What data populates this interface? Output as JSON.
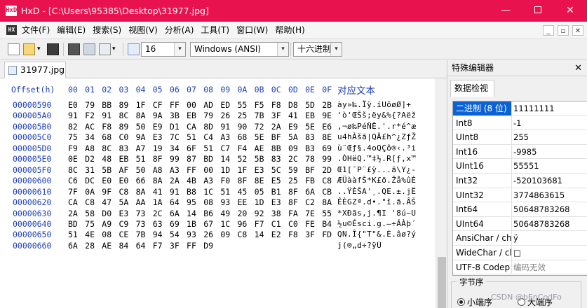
{
  "window": {
    "title": "HxD - [C:\\Users\\95385\\Desktop\\31977.jpg]",
    "app_icon_text": "HxD",
    "accent": "#e8124e",
    "controls": {
      "min": "—",
      "close": "✕"
    }
  },
  "menu": {
    "doc_icon_text": "HX",
    "items": [
      "文件(F)",
      "编辑(E)",
      "搜索(S)",
      "视图(V)",
      "分析(A)",
      "工具(T)",
      "窗口(W)",
      "帮助(H)"
    ],
    "mdi_controls": [
      "_",
      "▫",
      "✕"
    ]
  },
  "toolbar": {
    "bytes_per_row": "16",
    "charset": "Windows (ANSI)",
    "offset_base": "十六进制",
    "dropdown_glyph": "▾"
  },
  "tab": {
    "filename": "31977.jpg"
  },
  "hex": {
    "offset_header": "Offset(h)",
    "columns": [
      "00",
      "01",
      "02",
      "03",
      "04",
      "05",
      "06",
      "07",
      "08",
      "09",
      "0A",
      "0B",
      "0C",
      "0D",
      "0E",
      "0F"
    ],
    "text_header": "对应文本",
    "rows": [
      {
        "offset": "00000590",
        "bytes": [
          "E0",
          "79",
          "BB",
          "89",
          "1F",
          "CF",
          "FF",
          "00",
          "AD",
          "ED",
          "55",
          "F5",
          "F8",
          "D8",
          "5D",
          "2B"
        ],
        "text": "àу»‰.Ïÿ.­íUõøØ]+"
      },
      {
        "offset": "000005A0",
        "bytes": [
          "91",
          "F2",
          "91",
          "8C",
          "8A",
          "9A",
          "3B",
          "EB",
          "79",
          "26",
          "25",
          "7B",
          "3F",
          "41",
          "EB",
          "9E"
        ],
        "text": "'ò'ŒŠš;ëy&%{?Aëž"
      },
      {
        "offset": "000005B0",
        "bytes": [
          "82",
          "AC",
          "F8",
          "89",
          "50",
          "E9",
          "D1",
          "CA",
          "8D",
          "91",
          "90",
          "72",
          "2A",
          "E9",
          "5E",
          "E6"
        ],
        "text": ",¬ø‰PéÑÊ.'.r*é^æ"
      },
      {
        "offset": "000005C0",
        "bytes": [
          "75",
          "34",
          "68",
          "C0",
          "9A",
          "E3",
          "7C",
          "51",
          "C4",
          "A3",
          "68",
          "5E",
          "BF",
          "5A",
          "83",
          "8E"
        ],
        "text": "u4hÀšã|QÄ£h^¿ZƒŽ"
      },
      {
        "offset": "000005D0",
        "bytes": [
          "F9",
          "A8",
          "8C",
          "83",
          "A7",
          "19",
          "34",
          "6F",
          "51",
          "C7",
          "F4",
          "AE",
          "8B",
          "09",
          "B3",
          "69"
        ],
        "text": "ù¨Œƒ§.4oQÇô®‹.³i"
      },
      {
        "offset": "000005E0",
        "bytes": [
          "0E",
          "D2",
          "48",
          "EB",
          "51",
          "8F",
          "99",
          "87",
          "BD",
          "14",
          "52",
          "5B",
          "83",
          "2C",
          "78",
          "99"
        ],
        "text": ".ÒHëQ.™‡½.R[ƒ,x™"
      },
      {
        "offset": "000005F0",
        "bytes": [
          "8C",
          "31",
          "5B",
          "AF",
          "50",
          "A8",
          "A3",
          "FF",
          "00",
          "1D",
          "1F",
          "E3",
          "5C",
          "59",
          "BF",
          "2D"
        ],
        "text": "Œ1[¯P¨£ÿ...ã\\Y¿-"
      },
      {
        "offset": "00000600",
        "bytes": [
          "C6",
          "DC",
          "E0",
          "E0",
          "66",
          "8A",
          "2A",
          "4B",
          "A3",
          "F0",
          "8F",
          "8E",
          "E5",
          "25",
          "FB",
          "C8"
        ],
        "text": "ÆÜààfŠ*K£ð.Žå%ûÈ"
      },
      {
        "offset": "00000610",
        "bytes": [
          "7F",
          "0A",
          "9F",
          "C8",
          "8A",
          "41",
          "91",
          "B8",
          "1C",
          "51",
          "45",
          "05",
          "B1",
          "8F",
          "6A",
          "CB"
        ],
        "text": "..ŸÈŠA'¸.QE.±.jË"
      },
      {
        "offset": "00000620",
        "bytes": [
          "CA",
          "C8",
          "47",
          "5A",
          "AA",
          "1A",
          "64",
          "95",
          "08",
          "93",
          "EE",
          "1D",
          "E3",
          "8F",
          "C2",
          "8A"
        ],
        "text": "ÊÈGZª.d•.\"î.ã.ÂŠ"
      },
      {
        "offset": "00000630",
        "bytes": [
          "2A",
          "58",
          "D0",
          "E3",
          "73",
          "2C",
          "6A",
          "14",
          "B6",
          "49",
          "20",
          "92",
          "38",
          "FA",
          "7E",
          "55"
        ],
        "text": "*XÐãs,j.¶I '8ú~U"
      },
      {
        "offset": "00000640",
        "bytes": [
          "BD",
          "75",
          "A9",
          "C9",
          "73",
          "63",
          "69",
          "1B",
          "67",
          "1C",
          "96",
          "F7",
          "C1",
          "C0",
          "FE",
          "B4"
        ],
        "text": "½u©Ésci.g.–÷ÁÀþ´"
      },
      {
        "offset": "00000650",
        "bytes": [
          "51",
          "4E",
          "08",
          "CE",
          "7B",
          "94",
          "54",
          "93",
          "26",
          "09",
          "C8",
          "14",
          "E2",
          "F8",
          "3F",
          "FD"
        ],
        "text": "QN.Î{\"T\"&.È.âø?ý"
      },
      {
        "offset": "00000660",
        "bytes": [
          "6A",
          "28",
          "AE",
          "84",
          "64",
          "F7",
          "3F",
          "FF",
          "D9"
        ],
        "text": "j(®„d÷?ÿÙ"
      }
    ]
  },
  "inspector": {
    "title": "特殊编辑器",
    "close": "✕",
    "tab": "数据检视",
    "rows": [
      {
        "name": "二进制 (8 位)",
        "value": "11111111",
        "selected": true
      },
      {
        "name": "Int8",
        "value": "-1"
      },
      {
        "name": "UInt8",
        "value": "255"
      },
      {
        "name": "Int16",
        "value": "-9985"
      },
      {
        "name": "UInt16",
        "value": "55551"
      },
      {
        "name": "Int32",
        "value": "-520103681"
      },
      {
        "name": "UInt32",
        "value": "3774863615"
      },
      {
        "name": "Int64",
        "value": "50648783268"
      },
      {
        "name": "UInt64",
        "value": "50648783268"
      },
      {
        "name": "AnsiChar / ch",
        "value": "ÿ"
      },
      {
        "name": "WideChar / cl",
        "value": "□"
      },
      {
        "name": "UTF-8 Codep",
        "value": "编码无效",
        "gray": true
      }
    ],
    "byte_order_label": "字节序",
    "little_endian": "小端序",
    "big_endian": "大端序",
    "selected_color": "#0a63d6"
  },
  "watermark": "CSDN @bEnCodFo"
}
